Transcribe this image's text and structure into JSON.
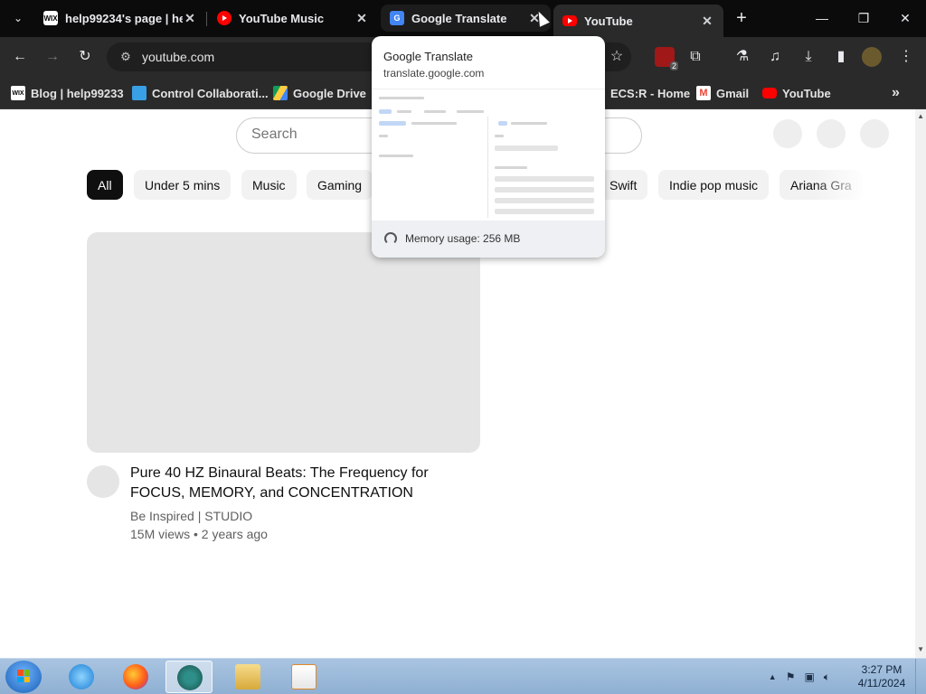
{
  "browser": {
    "tabs": [
      {
        "title": "help99234's page | he",
        "favicon": "wix-icon"
      },
      {
        "title": "YouTube Music",
        "favicon": "youtube-music-icon"
      },
      {
        "title": "Google Translate",
        "favicon": "google-translate-icon"
      },
      {
        "title": "YouTube",
        "favicon": "youtube-icon",
        "active": true
      }
    ],
    "tab_close_glyph": "✕",
    "new_tab_glyph": "+",
    "tab_search_glyph": "⌄",
    "window_controls": {
      "minimize": "—",
      "restore": "❐",
      "close": "✕"
    },
    "url": "youtube.com",
    "nav": {
      "back": "←",
      "forward": "→",
      "reload": "↻"
    },
    "bookmarks": [
      {
        "label": "Blog | help99233",
        "icon": "wix-icon"
      },
      {
        "label": "Control Collaborati...",
        "icon": "control-icon"
      },
      {
        "label": "Google Drive",
        "icon": "google-drive-icon"
      },
      {
        "label": "ECS:R - Home",
        "icon": "ecs-icon"
      },
      {
        "label": "Gmail",
        "icon": "gmail-icon"
      },
      {
        "label": "YouTube",
        "icon": "youtube-icon"
      }
    ],
    "bookmarks_overflow": "»",
    "extension_badge": "2"
  },
  "hover_card": {
    "title": "Google Translate",
    "domain": "translate.google.com",
    "memory": "Memory usage: 256 MB"
  },
  "youtube": {
    "search_placeholder": "Search",
    "chips": [
      "All",
      "Under 5 mins",
      "Music",
      "Gaming",
      "Swift",
      "Indie pop music",
      "Ariana Gra"
    ],
    "video": {
      "title": "Pure 40 HZ Binaural Beats: The Frequency for FOCUS, MEMORY, and CONCENTRATION",
      "channel": "Be Inspired | STUDIO",
      "meta": "15M views • 2 years ago"
    }
  },
  "taskbar": {
    "time": "3:27 PM",
    "date": "4/11/2024",
    "tray_up_arrow": "▲"
  }
}
